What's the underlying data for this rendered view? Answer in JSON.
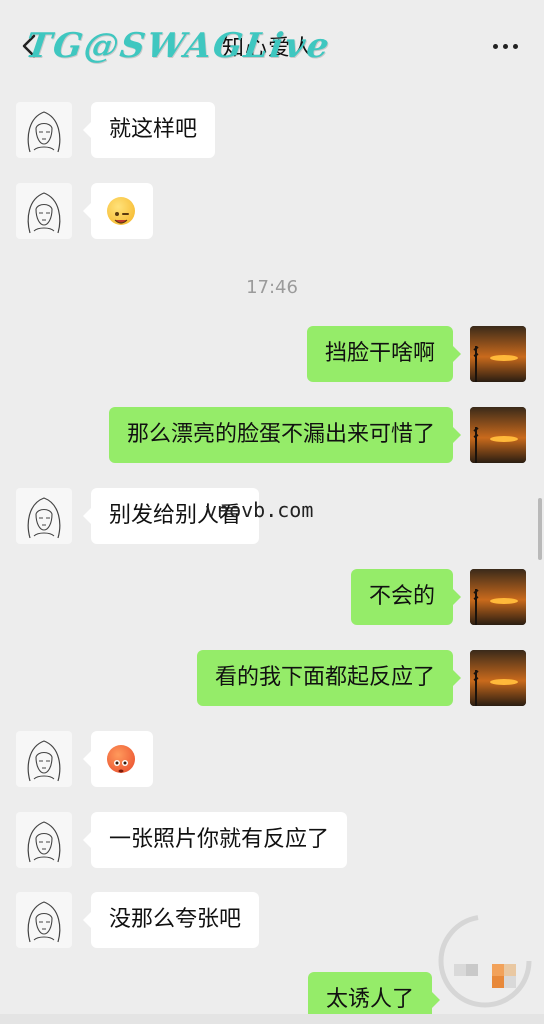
{
  "header": {
    "title": "知心爱人",
    "watermark": "TG@SWAGLive"
  },
  "messages": [
    {
      "side": "left",
      "type": "text",
      "text": "就这样吧"
    },
    {
      "side": "left",
      "type": "emoji",
      "emoji": "winking-face-with-tongue"
    },
    {
      "type": "time",
      "text": "17:46"
    },
    {
      "side": "right",
      "type": "text",
      "text": "挡脸干啥啊"
    },
    {
      "side": "right",
      "type": "text",
      "text": "那么漂亮的脸蛋不漏出来可惜了"
    },
    {
      "side": "left",
      "type": "text",
      "text": "别发给别人看"
    },
    {
      "side": "right",
      "type": "text",
      "text": "不会的"
    },
    {
      "side": "right",
      "type": "text",
      "text": "看的我下面都起反应了"
    },
    {
      "side": "left",
      "type": "emoji",
      "emoji": "flushed-face"
    },
    {
      "side": "left",
      "type": "text",
      "text": "一张照片你就有反应了"
    },
    {
      "side": "left",
      "type": "text",
      "text": "没那么夸张吧"
    },
    {
      "side": "right",
      "type": "text",
      "text": "太诱人了"
    }
  ],
  "overlay": {
    "url_text": "vnovb.com"
  },
  "colors": {
    "background": "#ededed",
    "bubble_self": "#95ec69",
    "bubble_other": "#ffffff",
    "watermark": "#3fc7c0"
  }
}
